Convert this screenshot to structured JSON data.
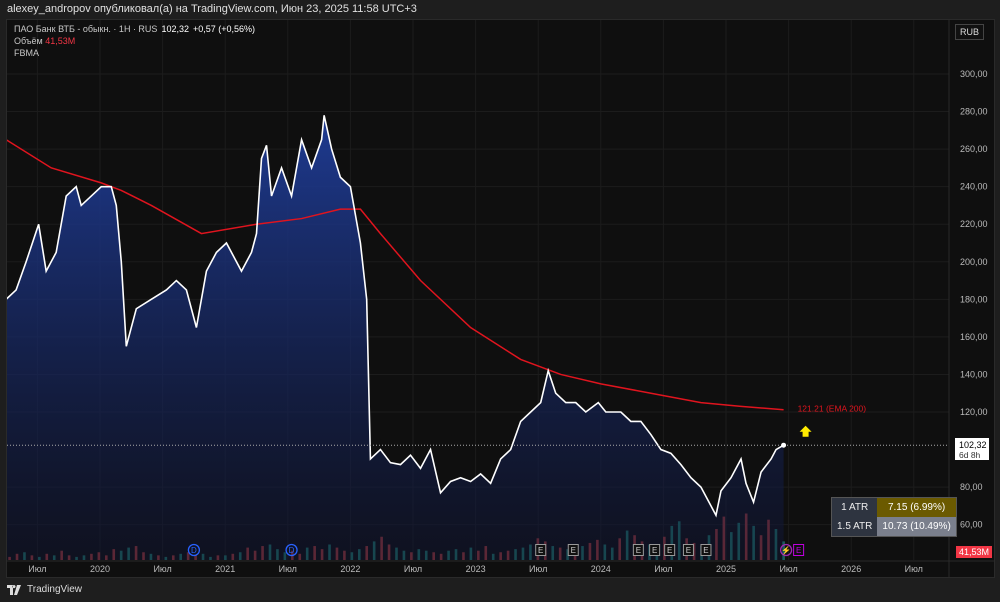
{
  "header": {
    "published": "alexey_andropov опубликовал(а) на TradingView.com, Июн 23, 2025 11:58 UTC+3"
  },
  "legend": {
    "symbol": "ПАО Банк ВТБ - обыкн. · 1H · RUS",
    "last": "102,32",
    "change": "+0,57 (+0,56%)",
    "volume_label": "Объём",
    "volume_value": "41,53M",
    "indicator": "FBMA"
  },
  "currency": "RUB",
  "price_label": {
    "value": "102,32",
    "countdown": "6d 8h"
  },
  "volume_label": "41,53M",
  "ema_label": "121.21 (EMA 200)",
  "atr": {
    "rows": [
      {
        "label": "1 ATR",
        "value": "7.15 (6.99%)"
      },
      {
        "label": "1.5 ATR",
        "value": "10.73 (10.49%)"
      }
    ]
  },
  "footer": {
    "brand": "TradingView"
  },
  "colors": {
    "line": "#ffffff",
    "ema": "#e0141e",
    "area_top": "#1f3d99",
    "up": "#1f7a6e",
    "down": "#a83a3a",
    "bg": "#0f0f0f"
  },
  "chart_data": {
    "type": "area",
    "title": "ПАО Банк ВТБ - обыкн. · 1H · RUS",
    "ylim": [
      50,
      310
    ],
    "xlim": [
      2019.2,
      2026.75
    ],
    "yticks": [
      "300,00",
      "280,00",
      "260,00",
      "240,00",
      "220,00",
      "200,00",
      "180,00",
      "160,00",
      "140,00",
      "120,00",
      "80,00",
      "60,00"
    ],
    "ytick_values": [
      300,
      280,
      260,
      240,
      220,
      200,
      180,
      160,
      140,
      120,
      80,
      60
    ],
    "xticks": [
      {
        "t": 2019.5,
        "label": "Июл"
      },
      {
        "t": 2020,
        "label": "2020"
      },
      {
        "t": 2020.5,
        "label": "Июл"
      },
      {
        "t": 2021,
        "label": "2021"
      },
      {
        "t": 2021.5,
        "label": "Июл"
      },
      {
        "t": 2022,
        "label": "2022"
      },
      {
        "t": 2022.5,
        "label": "Июл"
      },
      {
        "t": 2023,
        "label": "2023"
      },
      {
        "t": 2023.5,
        "label": "Июл"
      },
      {
        "t": 2024,
        "label": "2024"
      },
      {
        "t": 2024.5,
        "label": "Июл"
      },
      {
        "t": 2025,
        "label": "2025"
      },
      {
        "t": 2025.5,
        "label": "Июл"
      },
      {
        "t": 2026,
        "label": "2026"
      },
      {
        "t": 2026.5,
        "label": "Июл"
      }
    ],
    "price": [
      [
        2019.25,
        180
      ],
      [
        2019.33,
        185
      ],
      [
        2019.41,
        200
      ],
      [
        2019.51,
        220
      ],
      [
        2019.57,
        195
      ],
      [
        2019.65,
        205
      ],
      [
        2019.73,
        235
      ],
      [
        2019.81,
        240
      ],
      [
        2019.85,
        230
      ],
      [
        2019.93,
        235
      ],
      [
        2020.01,
        240
      ],
      [
        2020.09,
        240
      ],
      [
        2020.13,
        230
      ],
      [
        2020.17,
        200
      ],
      [
        2020.21,
        155
      ],
      [
        2020.29,
        175
      ],
      [
        2020.41,
        180
      ],
      [
        2020.53,
        185
      ],
      [
        2020.61,
        190
      ],
      [
        2020.69,
        185
      ],
      [
        2020.77,
        165
      ],
      [
        2020.85,
        195
      ],
      [
        2020.93,
        205
      ],
      [
        2021.01,
        210
      ],
      [
        2021.13,
        195
      ],
      [
        2021.21,
        205
      ],
      [
        2021.25,
        215
      ],
      [
        2021.29,
        255
      ],
      [
        2021.33,
        262
      ],
      [
        2021.37,
        235
      ],
      [
        2021.45,
        250
      ],
      [
        2021.53,
        235
      ],
      [
        2021.61,
        265
      ],
      [
        2021.69,
        250
      ],
      [
        2021.77,
        265
      ],
      [
        2021.79,
        278
      ],
      [
        2021.85,
        260
      ],
      [
        2021.92,
        245
      ],
      [
        2022.0,
        240
      ],
      [
        2022.08,
        210
      ],
      [
        2022.13,
        180
      ],
      [
        2022.16,
        95
      ],
      [
        2022.24,
        100
      ],
      [
        2022.32,
        93
      ],
      [
        2022.4,
        92
      ],
      [
        2022.48,
        97
      ],
      [
        2022.56,
        90
      ],
      [
        2022.64,
        100
      ],
      [
        2022.72,
        77
      ],
      [
        2022.8,
        83
      ],
      [
        2022.88,
        85
      ],
      [
        2022.96,
        83
      ],
      [
        2023.04,
        87
      ],
      [
        2023.12,
        82
      ],
      [
        2023.2,
        95
      ],
      [
        2023.28,
        100
      ],
      [
        2023.36,
        115
      ],
      [
        2023.44,
        120
      ],
      [
        2023.52,
        125
      ],
      [
        2023.58,
        142
      ],
      [
        2023.64,
        130
      ],
      [
        2023.72,
        125
      ],
      [
        2023.8,
        125
      ],
      [
        2023.88,
        120
      ],
      [
        2023.98,
        125
      ],
      [
        2024.04,
        120
      ],
      [
        2024.16,
        120
      ],
      [
        2024.24,
        115
      ],
      [
        2024.32,
        115
      ],
      [
        2024.4,
        108
      ],
      [
        2024.48,
        100
      ],
      [
        2024.56,
        98
      ],
      [
        2024.64,
        92
      ],
      [
        2024.72,
        85
      ],
      [
        2024.8,
        80
      ],
      [
        2024.88,
        70
      ],
      [
        2024.92,
        65
      ],
      [
        2024.96,
        78
      ],
      [
        2025.04,
        85
      ],
      [
        2025.12,
        95
      ],
      [
        2025.16,
        82
      ],
      [
        2025.22,
        72
      ],
      [
        2025.28,
        88
      ],
      [
        2025.36,
        95
      ],
      [
        2025.4,
        100
      ],
      [
        2025.46,
        102.32
      ]
    ],
    "ema200": [
      [
        2019.25,
        265
      ],
      [
        2019.61,
        250
      ],
      [
        2020.01,
        242
      ],
      [
        2020.17,
        238
      ],
      [
        2020.41,
        230
      ],
      [
        2020.81,
        215
      ],
      [
        2021.25,
        220
      ],
      [
        2021.61,
        223
      ],
      [
        2021.92,
        228
      ],
      [
        2022.08,
        228
      ],
      [
        2022.24,
        215
      ],
      [
        2022.56,
        190
      ],
      [
        2022.96,
        165
      ],
      [
        2023.36,
        148
      ],
      [
        2023.68,
        140
      ],
      [
        2024.0,
        135
      ],
      [
        2024.4,
        130
      ],
      [
        2024.8,
        125
      ],
      [
        2025.12,
        123
      ],
      [
        2025.46,
        121.21
      ]
    ],
    "volume": [
      3,
      2,
      4,
      5,
      3,
      2,
      4,
      3,
      6,
      3,
      2,
      3,
      4,
      5,
      3,
      7,
      6,
      8,
      9,
      5,
      4,
      3,
      2,
      3,
      4,
      5,
      3,
      4,
      2,
      3,
      3,
      4,
      5,
      8,
      6,
      9,
      10,
      7,
      5,
      6,
      4,
      8,
      9,
      7,
      10,
      8,
      6,
      5,
      7,
      9,
      12,
      15,
      10,
      8,
      6,
      5,
      7,
      6,
      5,
      4,
      6,
      7,
      5,
      8,
      6,
      9,
      4,
      5,
      6,
      7,
      8,
      10,
      14,
      12,
      9,
      8,
      7,
      6,
      9,
      11,
      13,
      10,
      8,
      14,
      19,
      16,
      12,
      10,
      8,
      15,
      22,
      25,
      14,
      11,
      9,
      16,
      20,
      28,
      18,
      24,
      30,
      22,
      16,
      26,
      20,
      12
    ],
    "volume_up": "uddudududduudddduuddudududduudududdduuudduddudduududduuduudduududdudduuuddudududduududduuduudduudduududduud",
    "events": [
      {
        "t": 2020.75,
        "label": "D"
      },
      {
        "t": 2021.53,
        "label": "D"
      },
      {
        "t": 2023.52,
        "label": "E"
      },
      {
        "t": 2023.78,
        "label": "E"
      },
      {
        "t": 2024.3,
        "label": "E"
      },
      {
        "t": 2024.43,
        "label": "E"
      },
      {
        "t": 2024.55,
        "label": "E"
      },
      {
        "t": 2024.7,
        "label": "E"
      },
      {
        "t": 2024.84,
        "label": "E"
      },
      {
        "t": 2025.48,
        "label": "⚡"
      },
      {
        "t": 2025.58,
        "label": "E"
      }
    ]
  }
}
